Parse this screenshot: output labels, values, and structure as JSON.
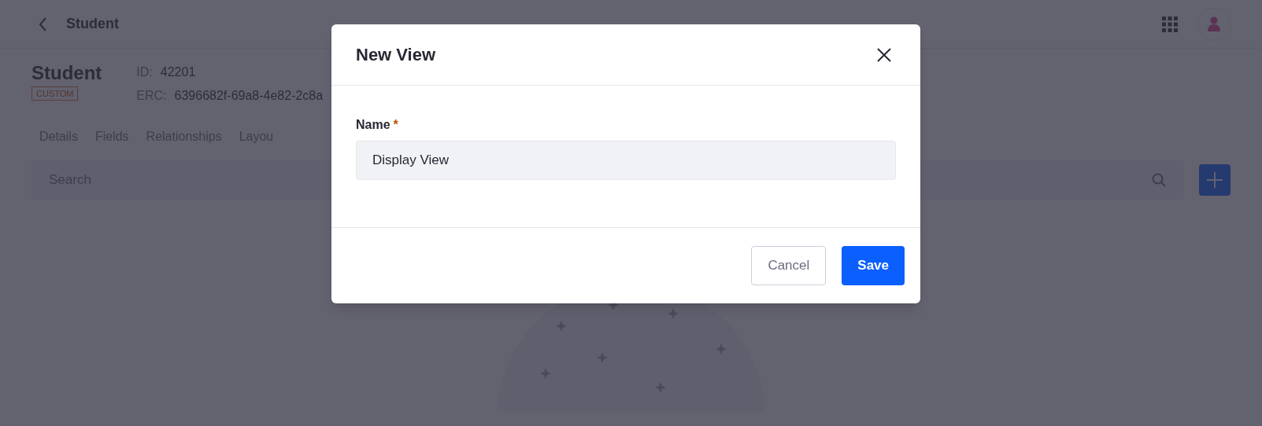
{
  "header": {
    "back_title": "Student"
  },
  "object": {
    "title": "Student",
    "badge": "CUSTOM",
    "id_label": "ID:",
    "id_value": "42201",
    "erc_label": "ERC:",
    "erc_value": "6396682f-69a8-4e82-2c8a"
  },
  "tabs": [
    {
      "label": "Details",
      "selected": false
    },
    {
      "label": "Fields",
      "selected": false
    },
    {
      "label": "Relationships",
      "selected": false
    },
    {
      "label": "Layou",
      "selected": false
    }
  ],
  "search": {
    "placeholder": "Search"
  },
  "dialog": {
    "title": "New View",
    "field_label": "Name",
    "required_mark": "*",
    "field_value": "Display View",
    "buttons": [
      {
        "label": "Cancel",
        "kind": "secondary"
      },
      {
        "label": "Save",
        "kind": "primary"
      }
    ]
  }
}
